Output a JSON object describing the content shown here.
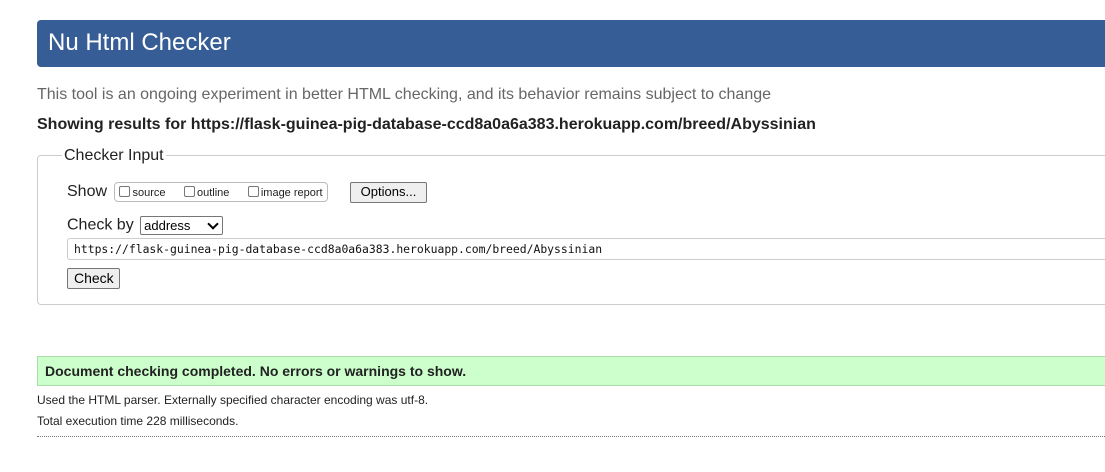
{
  "header": {
    "title": "Nu Html Checker"
  },
  "tagline": "This tool is an ongoing experiment in better HTML checking, and its behavior remains subject to change",
  "showing_results": "Showing results for https://flask-guinea-pig-database-ccd8a0a6a383.herokuapp.com/breed/Abyssinian",
  "checker_input": {
    "legend": "Checker Input",
    "show_label": "Show",
    "show_options": [
      {
        "label": "source",
        "checked": false
      },
      {
        "label": "outline",
        "checked": false
      },
      {
        "label": "image report",
        "checked": false
      }
    ],
    "options_button": "Options...",
    "check_by_label": "Check by",
    "check_by_selected": "address",
    "url_value": "https://flask-guinea-pig-database-ccd8a0a6a383.herokuapp.com/breed/Abyssinian",
    "check_button": "Check"
  },
  "result": {
    "success_message": "Document checking completed. No errors or warnings to show.",
    "success_color": "#ccffcc",
    "parser_info": "Used the HTML parser. Externally specified character encoding was utf-8.",
    "execution_time": "Total execution time 228 milliseconds."
  },
  "colors": {
    "header_bg": "#365d95",
    "header_text": "#ffffff"
  }
}
